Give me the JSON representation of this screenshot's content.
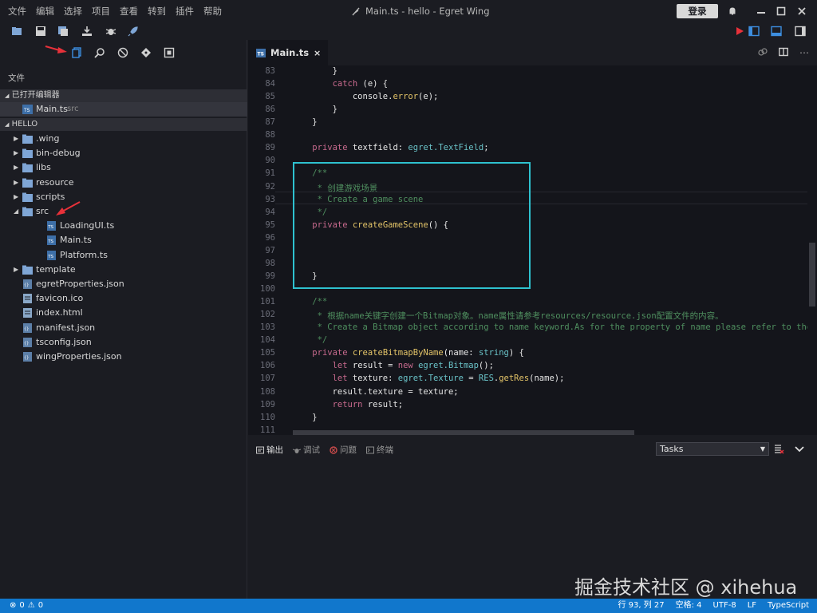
{
  "menu": [
    "文件",
    "编辑",
    "选择",
    "项目",
    "查看",
    "转到",
    "插件",
    "帮助"
  ],
  "window": {
    "title": "Main.ts - hello - Egret Wing",
    "login_label": "登录"
  },
  "sidebar": {
    "title": "文件",
    "open_editors": {
      "header": "已打开编辑器",
      "items": [
        {
          "name": "Main.ts",
          "folder": "src"
        }
      ]
    },
    "project": {
      "header": "HELLO",
      "items": [
        {
          "name": ".wing",
          "type": "folder",
          "level": 0,
          "expanded": false
        },
        {
          "name": "bin-debug",
          "type": "folder",
          "level": 0,
          "expanded": false
        },
        {
          "name": "libs",
          "type": "folder",
          "level": 0,
          "expanded": false
        },
        {
          "name": "resource",
          "type": "folder",
          "level": 0,
          "expanded": false
        },
        {
          "name": "scripts",
          "type": "folder",
          "level": 0,
          "expanded": false
        },
        {
          "name": "src",
          "type": "folder",
          "level": 0,
          "expanded": true
        },
        {
          "name": "LoadingUI.ts",
          "type": "ts",
          "level": 1
        },
        {
          "name": "Main.ts",
          "type": "ts",
          "level": 1
        },
        {
          "name": "Platform.ts",
          "type": "ts",
          "level": 1
        },
        {
          "name": "template",
          "type": "folder",
          "level": 0,
          "expanded": false
        },
        {
          "name": "egretProperties.json",
          "type": "json",
          "level": 0
        },
        {
          "name": "favicon.ico",
          "type": "file",
          "level": 0
        },
        {
          "name": "index.html",
          "type": "file",
          "level": 0
        },
        {
          "name": "manifest.json",
          "type": "json",
          "level": 0
        },
        {
          "name": "tsconfig.json",
          "type": "json",
          "level": 0
        },
        {
          "name": "wingProperties.json",
          "type": "json",
          "level": 0
        }
      ]
    }
  },
  "editor": {
    "tab_label": "Main.ts",
    "tab_close": "×",
    "lines": [
      {
        "n": "83",
        "text": "        }"
      },
      {
        "n": "84",
        "text": "        catch (e) {"
      },
      {
        "n": "85",
        "text": "            console.error(e);"
      },
      {
        "n": "86",
        "text": "        }"
      },
      {
        "n": "87",
        "text": "    }"
      },
      {
        "n": "88",
        "text": ""
      },
      {
        "n": "89",
        "text": "    private textfield: egret.TextField;"
      },
      {
        "n": "90",
        "text": ""
      },
      {
        "n": "91",
        "text": "    /**"
      },
      {
        "n": "92",
        "text": "     * 创建游戏场景"
      },
      {
        "n": "93",
        "text": "     * Create a game scene"
      },
      {
        "n": "94",
        "text": "     */"
      },
      {
        "n": "95",
        "text": "    private createGameScene() {"
      },
      {
        "n": "96",
        "text": ""
      },
      {
        "n": "97",
        "text": ""
      },
      {
        "n": "98",
        "text": ""
      },
      {
        "n": "99",
        "text": "    }"
      },
      {
        "n": "100",
        "text": ""
      },
      {
        "n": "101",
        "text": "    /**"
      },
      {
        "n": "102",
        "text": "     * 根据name关键字创建一个Bitmap对象。name属性请参考resources/resource.json配置文件的内容。"
      },
      {
        "n": "103",
        "text": "     * Create a Bitmap object according to name keyword.As for the property of name please refer to the"
      },
      {
        "n": "104",
        "text": "     */"
      },
      {
        "n": "105",
        "text": "    private createBitmapByName(name: string) {"
      },
      {
        "n": "106",
        "text": "        let result = new egret.Bitmap();"
      },
      {
        "n": "107",
        "text": "        let texture: egret.Texture = RES.getRes(name);"
      },
      {
        "n": "108",
        "text": "        result.texture = texture;"
      },
      {
        "n": "109",
        "text": "        return result;"
      },
      {
        "n": "110",
        "text": "    }"
      },
      {
        "n": "111",
        "text": ""
      }
    ]
  },
  "panel": {
    "tabs": [
      {
        "label": "输出",
        "icon": "output-icon"
      },
      {
        "label": "调试",
        "icon": "debug-icon"
      },
      {
        "label": "问题",
        "icon": "problems-icon"
      },
      {
        "label": "终端",
        "icon": "terminal-icon"
      }
    ],
    "task_select": "Tasks"
  },
  "statusbar": {
    "errors": "0",
    "warnings": "0",
    "position": "行 93, 列 27",
    "indent": "空格: 4",
    "encoding": "UTF-8",
    "eol": "LF",
    "language": "TypeScript"
  },
  "watermark": "掘金技术社区 @ xihehua",
  "colors": {
    "accent": "#1177cc",
    "highlight_box": "#2ec1cf",
    "arrow": "#e8313a"
  }
}
